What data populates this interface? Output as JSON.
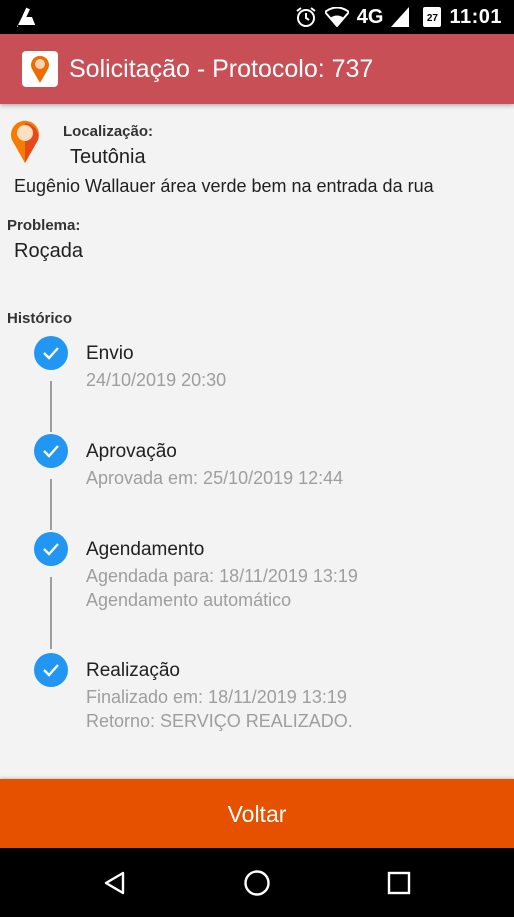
{
  "status_bar": {
    "network": "4G",
    "calendar_day": "27",
    "time": "11:01"
  },
  "app_bar": {
    "title": "Solicitação - Protocolo: 737"
  },
  "location": {
    "label": "Localização:",
    "city": "Teutônia",
    "address": "Eugênio Wallauer área verde bem na entrada da rua"
  },
  "problem": {
    "label": "Problema:",
    "value": "Roçada"
  },
  "history": {
    "label": "Histórico",
    "items": [
      {
        "title": "Envio",
        "lines": [
          "24/10/2019 20:30"
        ]
      },
      {
        "title": "Aprovação",
        "lines": [
          "Aprovada em: 25/10/2019 12:44"
        ]
      },
      {
        "title": "Agendamento",
        "lines": [
          "Agendada para: 18/11/2019 13:19",
          "Agendamento automático"
        ]
      },
      {
        "title": "Realização",
        "lines": [
          "Finalizado em: 18/11/2019 13:19",
          "Retorno: SERVIÇO REALIZADO."
        ]
      }
    ]
  },
  "actions": {
    "back_label": "Voltar"
  },
  "icons": {
    "status_left": "cleaner-broom-icon",
    "alarm": "alarm-clock-icon",
    "wifi": "wifi-icon",
    "signal": "cell-signal-icon",
    "calendar": "calendar-icon",
    "app_logo": "map-pin-logo-icon",
    "location": "map-pin-icon",
    "check": "check-circle-icon",
    "nav_back": "back-triangle-icon",
    "nav_home": "home-circle-icon",
    "nav_recents": "recents-square-icon"
  },
  "colors": {
    "app_bar": "#c84f55",
    "accent_blue": "#2196f3",
    "button_orange": "#e65100",
    "pin_orange": "#f57c00"
  }
}
